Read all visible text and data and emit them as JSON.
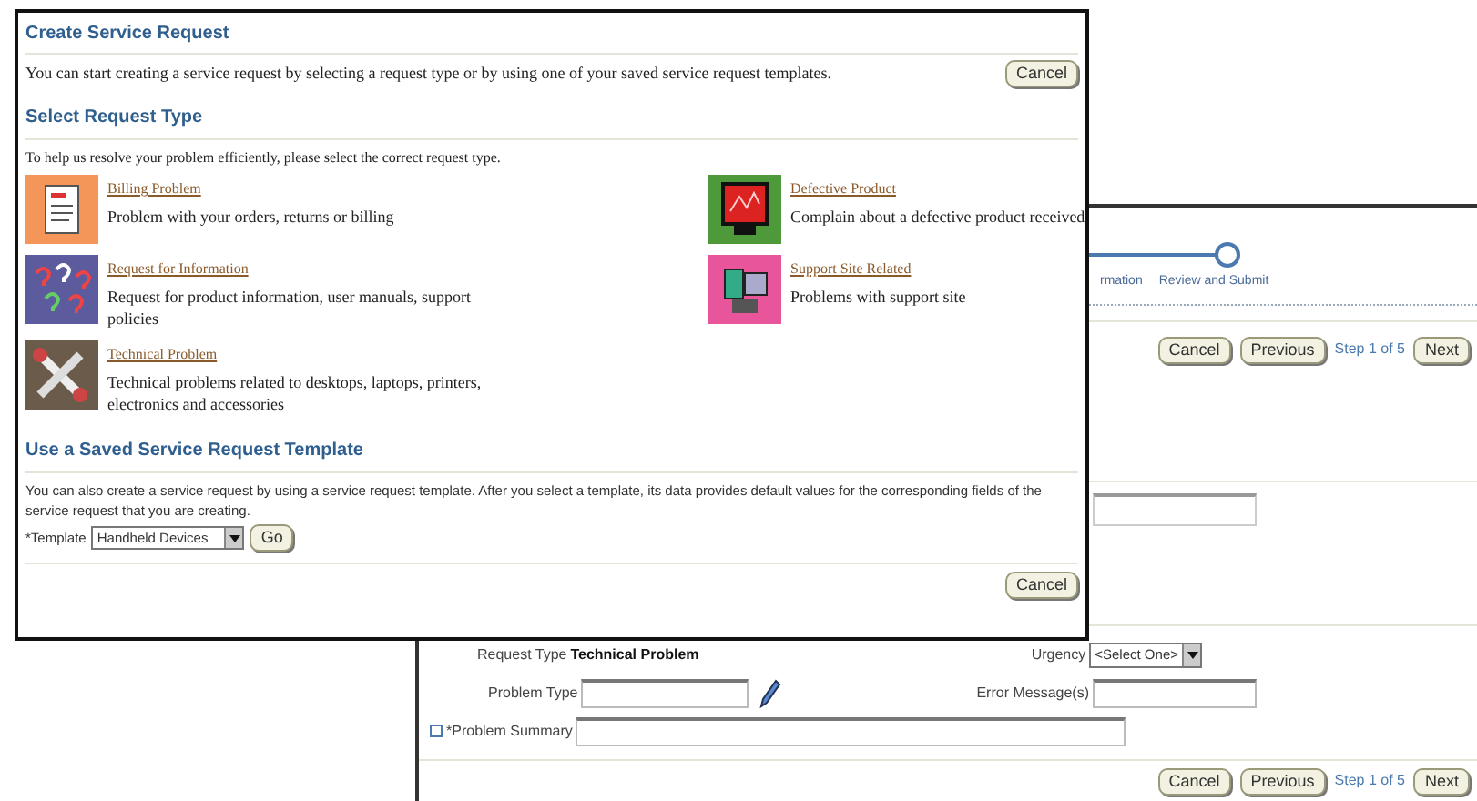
{
  "service_request_window": {
    "title": "Create Service Request",
    "intro": "You can start creating a service request by selecting a request type or by using one of your saved service request templates.",
    "cancel_button": "Cancel",
    "section_title": "Select Request Type",
    "instructions": "To help us resolve your problem efficiently, please select the correct request type.",
    "request_types": [
      {
        "kind": "billing",
        "name": "Billing Problem",
        "description": "Problem with your orders, returns or billing"
      },
      {
        "kind": "defective",
        "name": "Defective Product",
        "description": "Complain about a defective product received"
      },
      {
        "kind": "information",
        "name": "Request for Information",
        "description": "Request for product information, user manuals, support policies"
      },
      {
        "kind": "support",
        "name": "Support Site Related",
        "description": "Problems with support site"
      },
      {
        "kind": "technical",
        "name": "Technical Problem",
        "description": "Technical problems related to desktops, laptops, printers, electronics and accessories"
      }
    ],
    "template_section": {
      "title": "Use a Saved Service Request Template",
      "description": "You can also create a service request by using a service request template. After you select a template, its data provides default values for the corresponding fields of the service request that you are creating.",
      "field_label": "*Template",
      "template_value": "Handheld Devices",
      "go_button": "Go"
    },
    "footer_cancel_button": "Cancel"
  },
  "background_window": {
    "train_steps": [
      {
        "label": "rmation"
      },
      {
        "label": "Review and Submit"
      }
    ],
    "top_buttons": {
      "cancel": "Cancel",
      "previous": "Previous",
      "step": "Step 1 of 5",
      "next": "Next"
    },
    "form": {
      "request_type_label": "Request Type",
      "request_type_value": "Technical Problem",
      "urgency_label": "Urgency",
      "urgency_value": "<Select One>",
      "problem_type_label": "Problem Type",
      "error_messages_label": "Error Message(s)",
      "problem_summary_label": "*Problem Summary"
    },
    "bottom_buttons": {
      "cancel": "Cancel",
      "previous": "Previous",
      "step": "Step 1 of 5",
      "next": "Next"
    }
  }
}
